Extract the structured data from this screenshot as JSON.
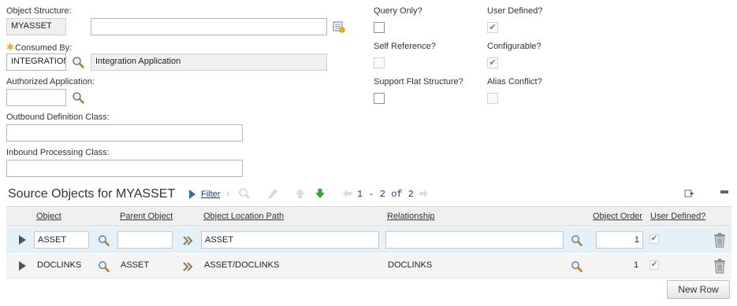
{
  "form": {
    "object_structure": {
      "label": "Object Structure:",
      "value": "MYASSET",
      "description": ""
    },
    "consumed_by": {
      "label": "Consumed By:",
      "value": "INTEGRATION",
      "description": "Integration Application"
    },
    "authorized_application": {
      "label": "Authorized Application:",
      "value": ""
    },
    "outbound_definition_class": {
      "label": "Outbound Definition Class:",
      "value": ""
    },
    "inbound_processing_class": {
      "label": "Inbound Processing Class:",
      "value": ""
    },
    "query_only": {
      "label": "Query Only?",
      "checked": false
    },
    "user_defined": {
      "label": "User Defined?",
      "checked": true
    },
    "self_reference": {
      "label": "Self Reference?",
      "checked": false
    },
    "configurable": {
      "label": "Configurable?",
      "checked": true
    },
    "support_flat_structure": {
      "label": "Support Flat Structure?",
      "checked": false
    },
    "alias_conflict": {
      "label": "Alias Conflict?",
      "checked": false
    }
  },
  "table": {
    "title": "Source Objects for MYASSET",
    "filter_label": "Filter",
    "pagination": "1 - 2 of 2",
    "columns": [
      "Object",
      "Parent Object",
      "Object Location Path",
      "Relationship",
      "Object Order",
      "User Defined?"
    ],
    "rows": [
      {
        "object": "ASSET",
        "parent_object": "",
        "location_path": "ASSET",
        "relationship": "",
        "order": "1",
        "user_defined": true
      },
      {
        "object": "DOCLINKS",
        "parent_object": "ASSET",
        "location_path": "ASSET/DOCLINKS",
        "relationship": "DOCLINKS",
        "order": "1",
        "user_defined": true
      }
    ],
    "new_row_label": "New Row"
  },
  "icons": {
    "lookup": "magnifier-icon",
    "detail_menu": "detail-menu-icon",
    "filter": "filter-icon",
    "download": "download-icon",
    "delete": "trash-icon",
    "go_to": "double-chevron-icon"
  },
  "colors": {
    "selected_row": "#e4f1f8",
    "required_marker": "#f5a623",
    "link": "#1c3c7c",
    "green_arrow": "#3aa535"
  }
}
